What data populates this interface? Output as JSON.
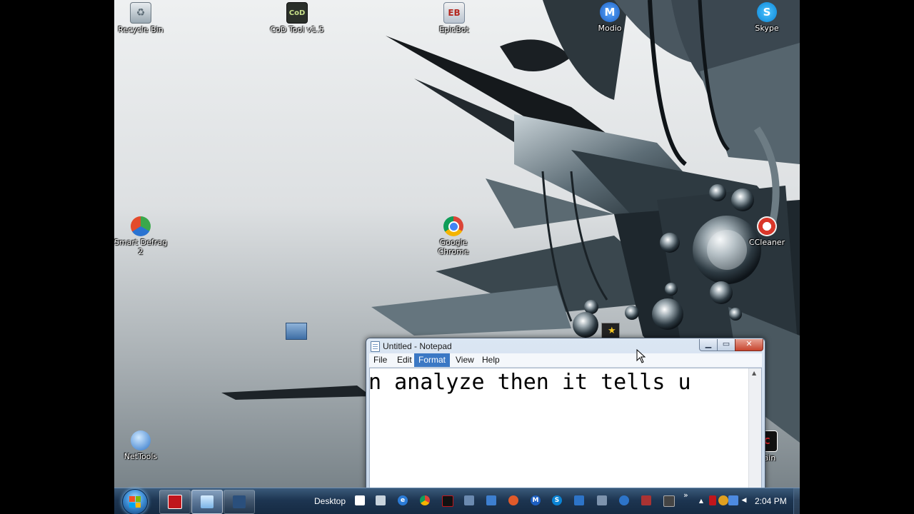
{
  "desktop_icons": [
    {
      "label": "Recycle Bin",
      "icon": "recycle-bin-icon"
    },
    {
      "label": "CoD Tool v1.5",
      "icon": "cod-tool-icon"
    },
    {
      "label": "EpicBot",
      "icon": "epicbot-icon"
    },
    {
      "label": "Modio",
      "icon": "modio-icon"
    },
    {
      "label": "Skype",
      "icon": "skype-icon"
    },
    {
      "label": "Smart Defrag 2",
      "icon": "smart-defrag-icon"
    },
    {
      "label": "Google Chrome",
      "icon": "chrome-icon"
    },
    {
      "label": "CCleaner",
      "icon": "ccleaner-icon"
    },
    {
      "label": "NetTools",
      "icon": "nettools-icon"
    },
    {
      "label": "Cain",
      "icon": "cain-icon"
    }
  ],
  "notepad": {
    "title": "Untitled - Notepad",
    "menu": [
      "File",
      "Edit",
      "Format",
      "View",
      "Help"
    ],
    "active_menu": "Format",
    "text": "n analyze then it tells u "
  },
  "taskbar": {
    "toolbar_label": "Desktop",
    "overflow_label": "»",
    "clock": "2:04 PM"
  },
  "colors": {
    "taskbar": "#1d3551",
    "active_menu": "#3b78c4",
    "close_button": "#c7432d"
  }
}
